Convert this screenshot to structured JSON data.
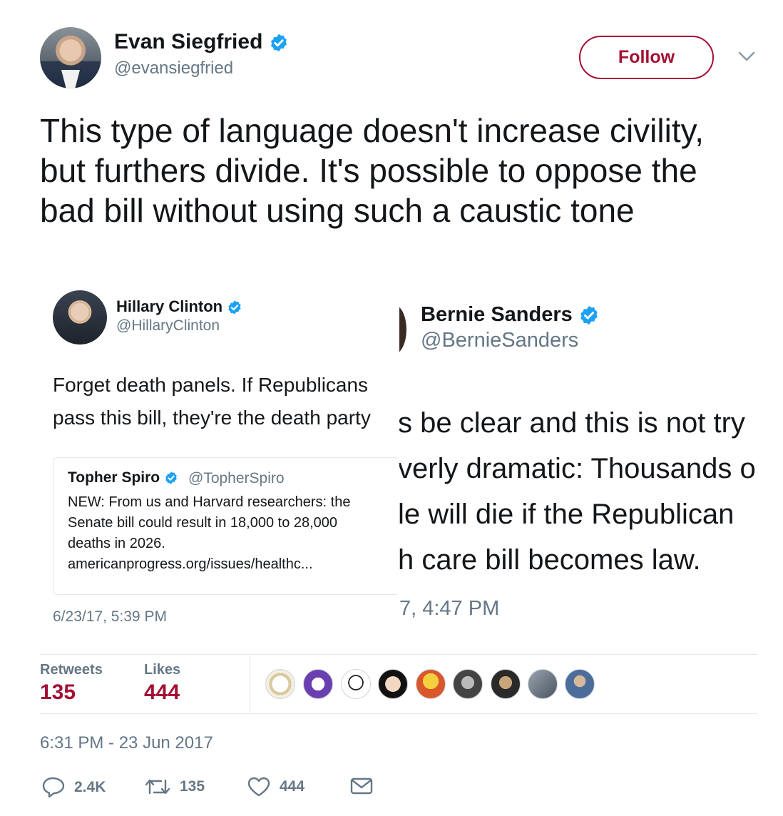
{
  "author": {
    "name": "Evan Siegfried",
    "handle": "@evansiegfried",
    "follow_label": "Follow"
  },
  "tweet": {
    "text": "This type of language doesn't increase civility, but furthers divide. It's possible to oppose the bad bill without using such a caustic tone",
    "timestamp": "6:31 PM - 23 Jun 2017"
  },
  "embedded_image": {
    "left_tweet": {
      "name": "Hillary Clinton",
      "handle": "@HillaryClinton",
      "text_line1": "Forget death panels. If Republicans",
      "text_line2": "pass this bill, they're the death party",
      "date": "6/23/17, 5:39 PM",
      "quote": {
        "name": "Topher Spiro",
        "handle": "@TopherSpiro",
        "line1": "NEW: From us and Harvard researchers: the",
        "line2": "Senate bill could result in 18,000 to 28,000",
        "line3": "deaths in 2026.",
        "line4": "americanprogress.org/issues/healthc..."
      }
    },
    "right_tweet": {
      "name": "Bernie Sanders",
      "handle": "@BernieSanders",
      "line1": "s be clear and this is not try",
      "line2": "verly dramatic: Thousands o",
      "line3": "le will die if the Republican",
      "line4": "h care bill becomes law.",
      "date": "7, 4:47 PM"
    }
  },
  "stats": {
    "retweets_label": "Retweets",
    "retweets_value": "135",
    "likes_label": "Likes",
    "likes_value": "444"
  },
  "actions": {
    "replies": "2.4K",
    "retweets": "135",
    "likes": "444"
  },
  "colors": {
    "accent": "#a50e33",
    "verified": "#1da1f2",
    "muted": "#657786",
    "text": "#14171a",
    "border": "#e1e8ed"
  },
  "icons": [
    "verified-icon",
    "chevron-down-icon",
    "reply-icon",
    "retweet-icon",
    "like-icon",
    "message-icon"
  ]
}
